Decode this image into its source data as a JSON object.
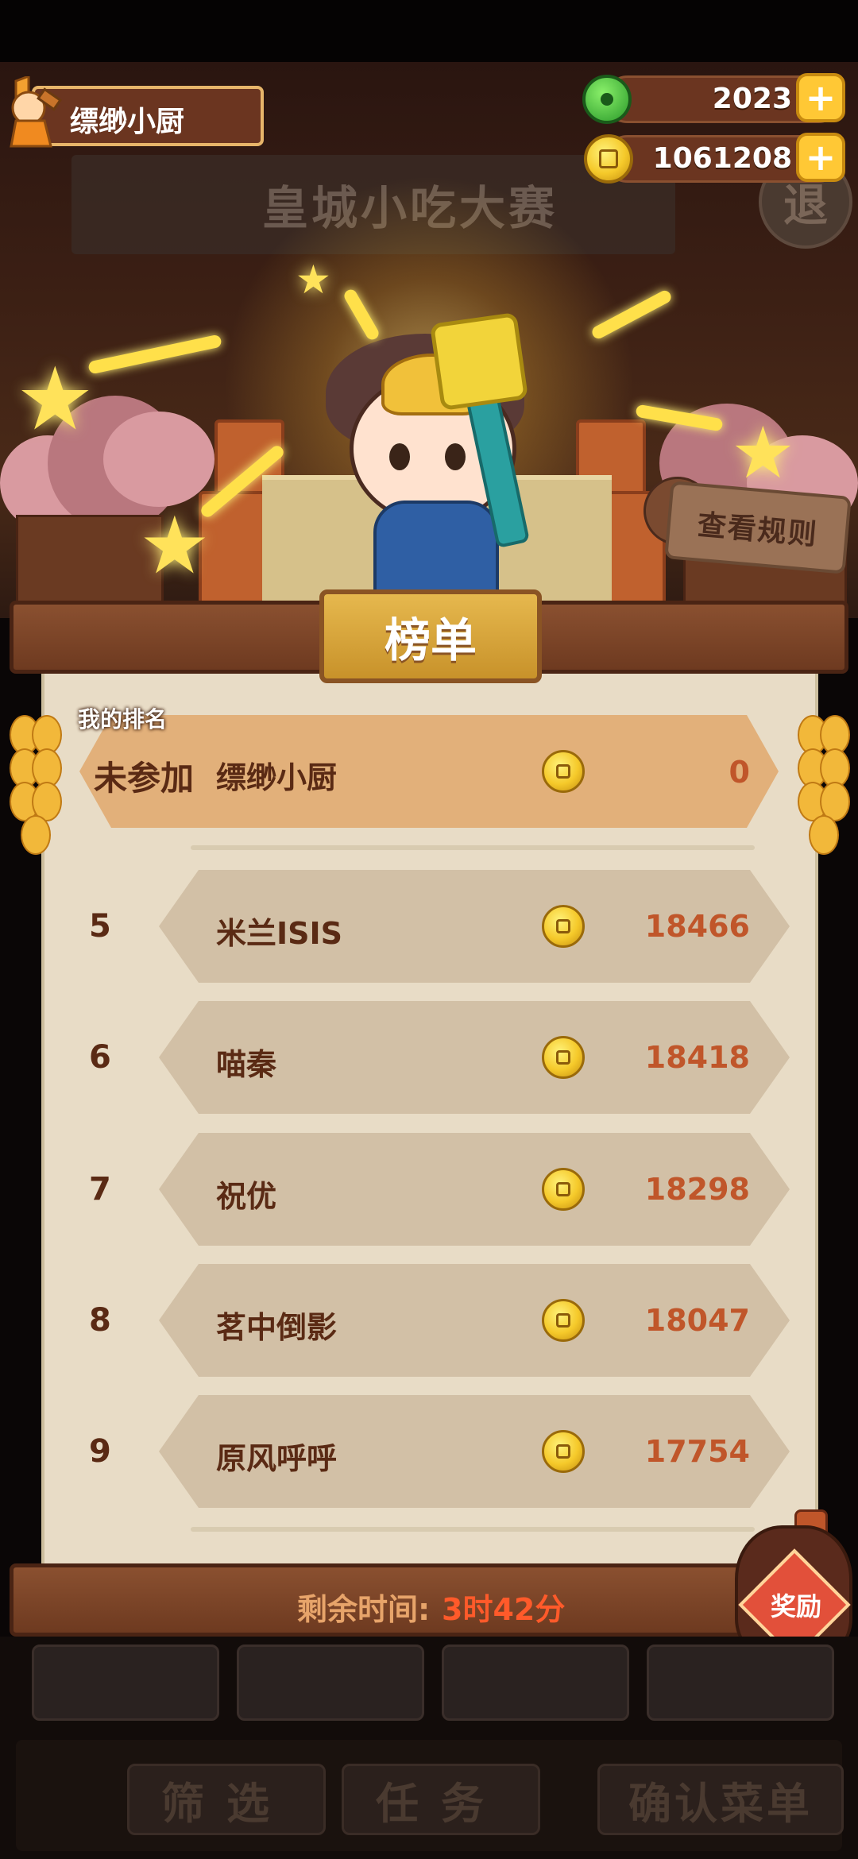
{
  "hud": {
    "player_name": "缥缈小厨",
    "jade": "2023",
    "coins": "1061208"
  },
  "scene": {
    "event_title": "皇城小吃大赛",
    "exit_label": "退",
    "rules_label": "查看规则"
  },
  "board": {
    "title": "榜单",
    "my_rank_label": "我的排名",
    "my_rank": {
      "status": "未参加",
      "name": "缥缈小厨",
      "score": "0"
    },
    "rows": [
      {
        "rank": "5",
        "name": "米兰ISIS",
        "score": "18466"
      },
      {
        "rank": "6",
        "name": "喵秦",
        "score": "18418"
      },
      {
        "rank": "7",
        "name": "祝优",
        "score": "18298"
      },
      {
        "rank": "8",
        "name": "茗中倒影",
        "score": "18047"
      },
      {
        "rank": "9",
        "name": "原风呼呼",
        "score": "17754"
      }
    ],
    "remaining_label": "剩余时间:",
    "remaining_value": "3时42分",
    "reward_label": "奖励"
  },
  "bottom_nav": {
    "filter": "筛选",
    "tasks": "任务",
    "confirm_menu": "确认菜单"
  },
  "colors": {
    "score": "#c0562a",
    "timer": "#ff5a2a",
    "tab_gold": "#e6b84e"
  }
}
